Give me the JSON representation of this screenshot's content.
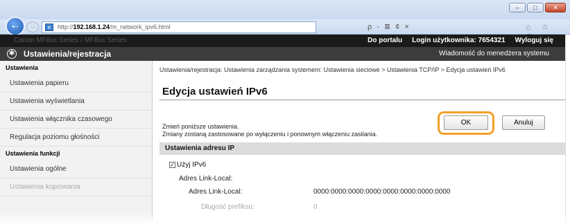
{
  "window": {
    "buttons": [
      "–",
      "□",
      "✕"
    ]
  },
  "navbar": {
    "url_prefix": "http://",
    "url_host": "192.168.1.24",
    "url_path": "/m_network_ipv6.html",
    "tools": "ρ - ≣ ¢ ×",
    "right_icons": "⌂ ☆ ⚙"
  },
  "topbar": {
    "device": "Canon  MF8xx Series / MF8xx Series",
    "portal_link": "Do portalu",
    "login_user": "Login użytkownika:  7654321",
    "logout_link": "Wyloguj się"
  },
  "appbar": {
    "title": "Ustawienia/rejestracja",
    "admin_message": "Wiadomość do menedżera systemu"
  },
  "sidebar": {
    "section1": "Ustawienia",
    "items1": [
      "Ustawienia papieru",
      "Ustawienia wyświetlania",
      "Ustawienia włącznika czasowego",
      "Regulacja poziomu głośności"
    ],
    "section2": "Ustawienia funkcji",
    "items2": [
      "Ustawienia ogólne",
      "Ustawienia kopiowania"
    ]
  },
  "main": {
    "breadcrumb": "Ustawienia/rejestracja: Ustawienia zarządzania systemem: Ustawienia sieciowe > Ustawienia TCP/IP > Edycja ustawień IPv6",
    "title": "Edycja ustawień IPv6",
    "info_line1": "Zmień poniższe ustawienia.",
    "info_line2": "Zmiany zostaną zastosowane po wyłączeniu i ponownym włączeniu zasilania.",
    "ok_label": "OK",
    "cancel_label": "Anuluj",
    "section_title": "Ustawienia adresu IP",
    "use_ipv6_label": "Użyj IPv6",
    "use_ipv6_checked": "✓",
    "link_local_label": "Adres Link-Local:",
    "link_local_addr_label": "Adres Link-Local:",
    "link_local_addr_value": "0000:0000:0000:0000:0000:0000:0000:0000",
    "prefix_label": "Długość prefiksu:",
    "prefix_value": "0"
  },
  "colors": {
    "highlight": "#f2a028",
    "header_black": "#1a1a1a",
    "section_gray": "#dcdcdc"
  }
}
